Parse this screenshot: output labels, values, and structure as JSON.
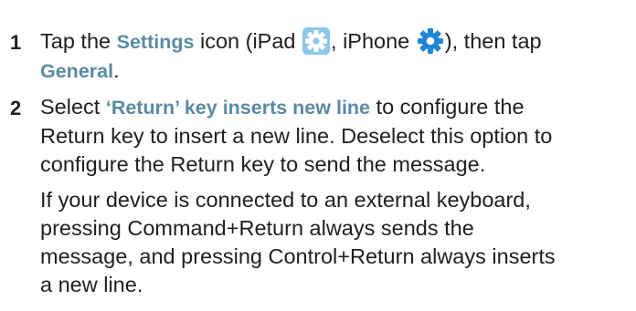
{
  "steps": [
    {
      "number": "1",
      "t1": "Tap the ",
      "settings": "Settings",
      "t2": " icon (iPad ",
      "t3": ", iPhone ",
      "t4": "), then tap",
      "general": "General",
      "t5": "."
    },
    {
      "number": "2",
      "t1": "Select ",
      "option": "‘Return’ key inserts new line",
      "t2": " to configure the",
      "line2": "Return key to insert a new line. Deselect this option to",
      "line3": "configure the Return key to send the message."
    }
  ],
  "note": {
    "line1": "If your device is connected to an external keyboard,",
    "line2": "pressing Command+Return always sends the",
    "line3": "message, and pressing Control+Return always inserts",
    "line4": "a new line."
  },
  "icons": {
    "ipad_settings": "gear-icon",
    "iphone_settings": "gear-icon"
  },
  "colors": {
    "highlight": "#5b8aa3",
    "icon_ipad": "#5aaee0",
    "icon_iphone": "#1f86d6"
  }
}
